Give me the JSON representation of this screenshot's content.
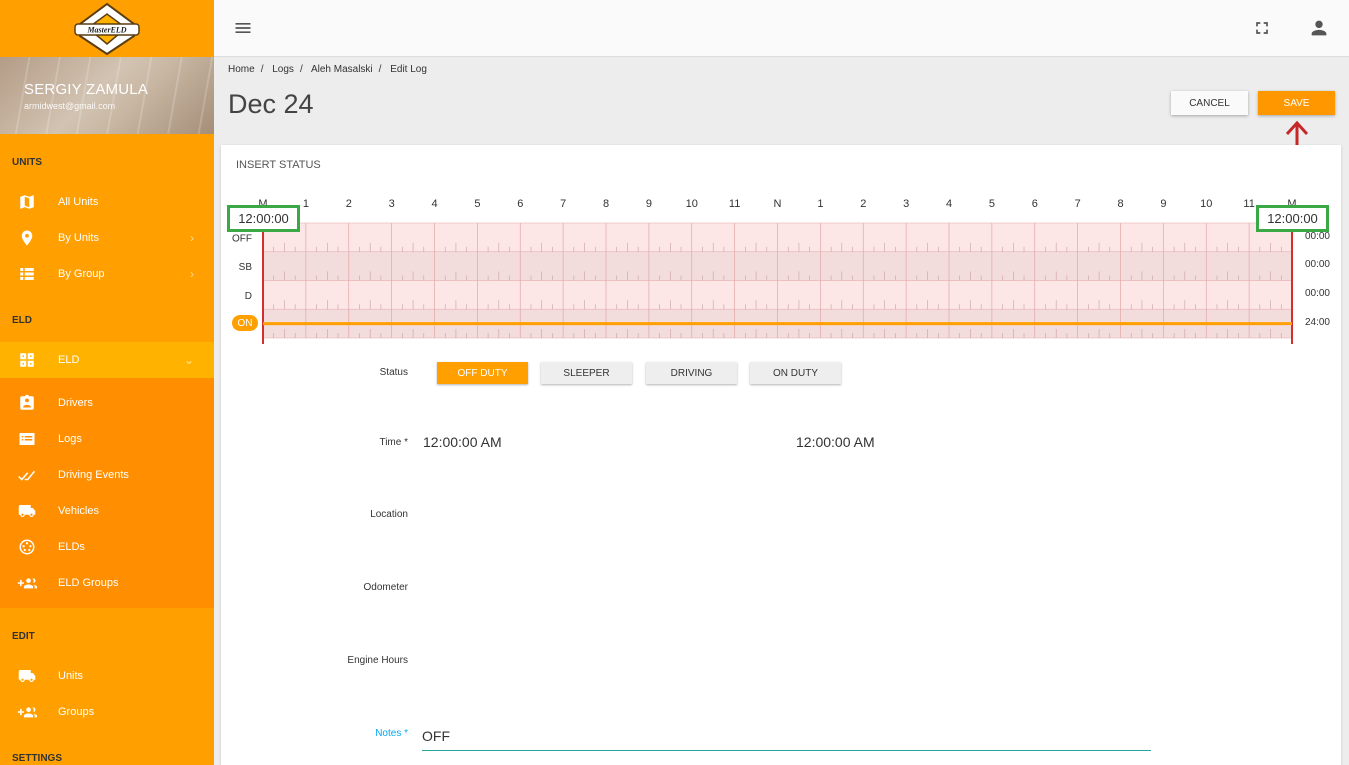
{
  "app": {
    "logo_text": "MasterELD",
    "brand_color": "#ffa000"
  },
  "user": {
    "name": "SERGIY ZAMULA",
    "email": "armidwest@gmail.com"
  },
  "sidebar": {
    "sections": {
      "units": "UNITS",
      "eld": "ELD",
      "edit": "EDIT",
      "settings": "SETTINGS"
    },
    "units_items": [
      {
        "label": "All Units",
        "icon": "map-icon"
      },
      {
        "label": "By Units",
        "icon": "location-pin-icon"
      },
      {
        "label": "By Group",
        "icon": "list-icon"
      }
    ],
    "eld_group": {
      "label": "ELD",
      "icon": "eld-icon"
    },
    "eld_items": [
      {
        "label": "Drivers",
        "icon": "driver-badge-icon"
      },
      {
        "label": "Logs",
        "icon": "logs-icon"
      },
      {
        "label": "Driving Events",
        "icon": "driving-events-icon"
      },
      {
        "label": "Vehicles",
        "icon": "truck-icon"
      },
      {
        "label": "ELDs",
        "icon": "eld-device-icon"
      },
      {
        "label": "ELD Groups",
        "icon": "group-add-icon"
      }
    ],
    "edit_items": [
      {
        "label": "Units",
        "icon": "truck-icon"
      },
      {
        "label": "Groups",
        "icon": "group-add-icon"
      }
    ]
  },
  "breadcrumb": [
    "Home",
    "Logs",
    "Aleh Masalski",
    "Edit Log"
  ],
  "page": {
    "title": "Dec 24",
    "cancel_label": "CANCEL",
    "save_label": "SAVE"
  },
  "card": {
    "title": "INSERT STATUS"
  },
  "chart": {
    "hours": [
      "M",
      "1",
      "2",
      "3",
      "4",
      "5",
      "6",
      "7",
      "8",
      "9",
      "10",
      "11",
      "N",
      "1",
      "2",
      "3",
      "4",
      "5",
      "6",
      "7",
      "8",
      "9",
      "10",
      "11",
      "M"
    ],
    "rows": [
      {
        "label": "OFF",
        "duration": "00:00"
      },
      {
        "label": "SB",
        "duration": "00:00"
      },
      {
        "label": "D",
        "duration": "00:00"
      },
      {
        "label": "ON",
        "duration": "24:00"
      }
    ],
    "active_row": "ON",
    "range_start": "12:00:00",
    "range_end": "12:00:00",
    "line_color": "#ffa000"
  },
  "form": {
    "status_label": "Status",
    "status_options": [
      "OFF DUTY",
      "SLEEPER",
      "DRIVING",
      "ON DUTY"
    ],
    "selected_status": "OFF DUTY",
    "time_label": "Time *",
    "time_start": "12:00:00 AM",
    "time_end": "12:00:00 AM",
    "location_label": "Location",
    "odometer_label": "Odometer",
    "engine_hours_label": "Engine Hours",
    "notes_label": "Notes *",
    "notes_value": "OFF"
  }
}
